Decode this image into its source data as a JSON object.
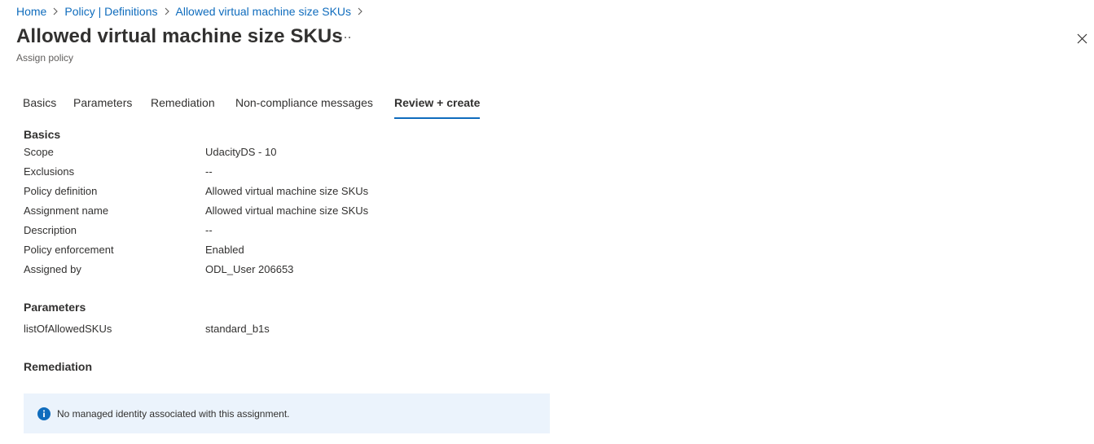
{
  "breadcrumb": {
    "items": [
      {
        "label": "Home"
      },
      {
        "label": "Policy | Definitions"
      },
      {
        "label": "Allowed virtual machine size SKUs"
      }
    ]
  },
  "header": {
    "title": "Allowed virtual machine size SKUs",
    "subtitle": "Assign policy",
    "more_icon": "ellipsis-icon",
    "close_icon": "close-icon"
  },
  "tabs": [
    {
      "label": "Basics",
      "active": false
    },
    {
      "label": "Parameters",
      "active": false
    },
    {
      "label": "Remediation",
      "active": false
    },
    {
      "label": "Non-compliance messages",
      "active": false
    },
    {
      "label": "Review + create",
      "active": true
    }
  ],
  "basics": {
    "title": "Basics",
    "rows": [
      {
        "label": "Scope",
        "value": "UdacityDS - 10"
      },
      {
        "label": "Exclusions",
        "value": "--"
      },
      {
        "label": "Policy definition",
        "value": "Allowed virtual machine size SKUs"
      },
      {
        "label": "Assignment name",
        "value": "Allowed virtual machine size SKUs"
      },
      {
        "label": "Description",
        "value": "--"
      },
      {
        "label": "Policy enforcement",
        "value": "Enabled"
      },
      {
        "label": "Assigned by",
        "value": "ODL_User 206653"
      }
    ]
  },
  "parameters": {
    "title": "Parameters",
    "rows": [
      {
        "label": "listOfAllowedSKUs",
        "value": "standard_b1s"
      }
    ]
  },
  "remediation": {
    "title": "Remediation",
    "info_icon": "info-icon",
    "info_message": "No managed identity associated with this assignment."
  },
  "colors": {
    "link": "#0f6cbd",
    "accent": "#0f6cbd",
    "text": "#323130",
    "info_background": "#ebf3fc",
    "info_icon": "#0f6cbd"
  }
}
